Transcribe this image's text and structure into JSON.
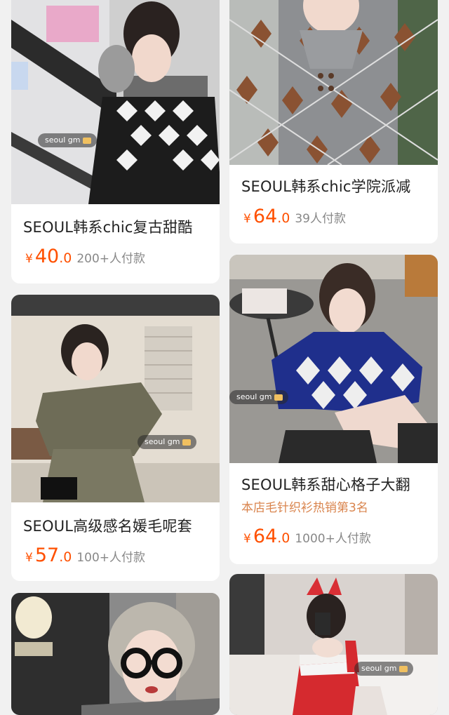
{
  "colors": {
    "price": "#ff5000",
    "rank": "#d9844d",
    "sales": "#888888",
    "title": "#222222",
    "background": "#f1f1f1"
  },
  "products": [
    {
      "title": "SEOUL韩系chic复古甜酷",
      "currency": "¥",
      "price_int": "40",
      "price_dec": ".0",
      "sales": "200+人付款",
      "tag": "seoul gm",
      "image": "woman-argyle-black-white-cardigan-photo"
    },
    {
      "title": "SEOUL韩系chic学院派减",
      "currency": "¥",
      "price_int": "64",
      "price_dec": ".0",
      "sales": "39人付款",
      "image": "woman-grey-argyle-polo-sweater-photo"
    },
    {
      "title": "SEOUL高级感名媛毛呢套",
      "currency": "¥",
      "price_int": "57",
      "price_dec": ".0",
      "sales": "100+人付款",
      "tag": "seoul gm",
      "image": "woman-olive-wool-jacket-skirt-photo"
    },
    {
      "title": "SEOUL韩系甜心格子大翻",
      "rank": "本店毛针织衫热销第3名",
      "currency": "¥",
      "price_int": "64",
      "price_dec": ".0",
      "sales": "1000+人付款",
      "tag": "seoul gm",
      "image": "woman-blue-argyle-collar-sweater-photo"
    },
    {
      "title": "",
      "tag": "",
      "image": "woman-glasses-tweed-jacket-photo"
    },
    {
      "title": "",
      "tag": "seoul gm",
      "image": "woman-red-bunny-costume-photo"
    }
  ]
}
